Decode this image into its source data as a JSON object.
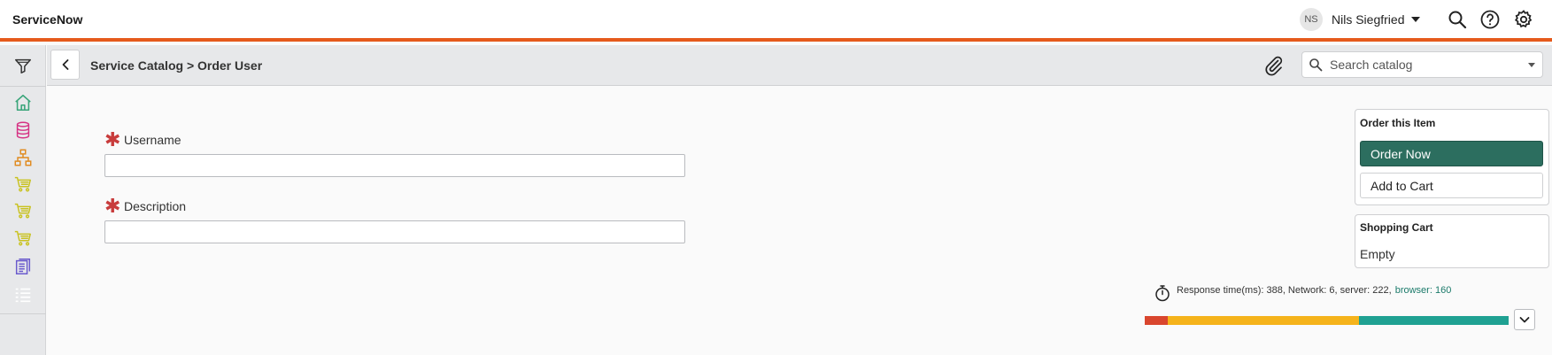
{
  "header": {
    "brand": "ServiceNow",
    "user_initials": "NS",
    "user_name": "Nils Siegfried",
    "accent_color": "#e55a1c"
  },
  "leftnav": {
    "items": [
      {
        "icon": "filter-icon"
      },
      {
        "icon": "home-icon",
        "color": "#3aa57a"
      },
      {
        "icon": "database-icon",
        "color": "#d63384"
      },
      {
        "icon": "org-chart-icon",
        "color": "#e08a1e"
      },
      {
        "icon": "cart-icon",
        "color": "#c9c221"
      },
      {
        "icon": "cart-icon",
        "color": "#c9c221"
      },
      {
        "icon": "cart-icon",
        "color": "#c9c221"
      },
      {
        "icon": "document-icon",
        "color": "#6a5acd"
      },
      {
        "icon": "list-icon",
        "color": "#ffffff"
      }
    ]
  },
  "subheader": {
    "breadcrumb": "Service Catalog > Order User",
    "search_placeholder": "Search catalog"
  },
  "form": {
    "fields": [
      {
        "label": "Username",
        "value": "",
        "required": true
      },
      {
        "label": "Description",
        "value": "",
        "required": true
      }
    ]
  },
  "order_panel": {
    "title": "Order this Item",
    "order_now": "Order Now",
    "add_to_cart": "Add to Cart",
    "primary_color": "#2c6e5f"
  },
  "cart_panel": {
    "title": "Shopping Cart",
    "status": "Empty"
  },
  "response": {
    "text": "Response time(ms): 388, Network: 6, server: 222,",
    "browser_text": "browser: 160",
    "segments": [
      {
        "name": "network",
        "value": 6,
        "color": "#d9462e"
      },
      {
        "name": "server",
        "value": 222,
        "color": "#f5b31b"
      },
      {
        "name": "browser",
        "value": 160,
        "color": "#1fa192"
      }
    ]
  }
}
